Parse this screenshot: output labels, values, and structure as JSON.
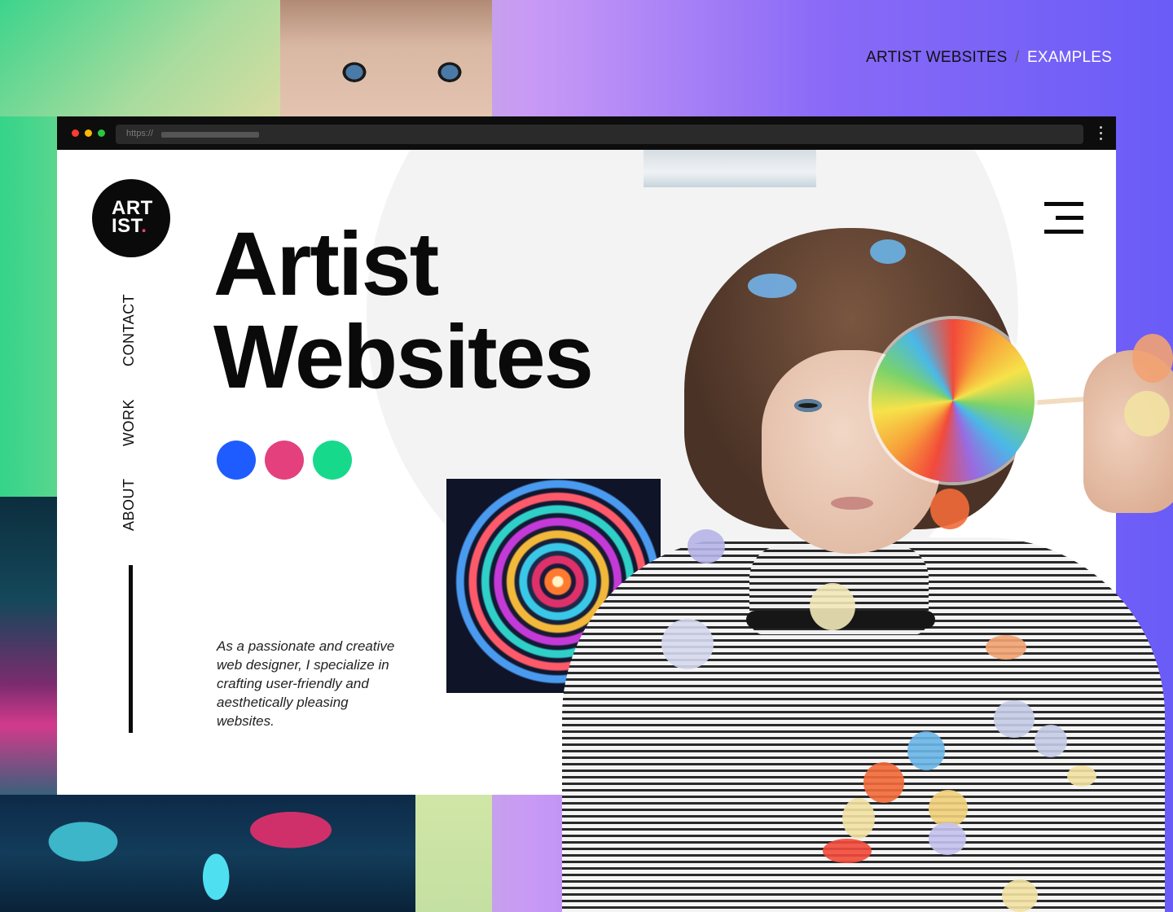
{
  "header": {
    "label_main": "ARTIST WEBSITES",
    "separator": "/",
    "label_sub": "EXAMPLES"
  },
  "browser": {
    "url_prefix": "https://",
    "traffic_lights": [
      "#ff3b30",
      "#ffb800",
      "#28c840"
    ]
  },
  "site": {
    "logo_line1": "ART",
    "logo_line2": "IST",
    "logo_dot": ".",
    "nav": [
      "CONTACT",
      "WORK",
      "ABOUT"
    ],
    "title_line1": "Artist",
    "title_line2": "Websites",
    "swatches": [
      "#1f5cff",
      "#e4407e",
      "#16d98c"
    ],
    "tagline": "As a passionate and creative web designer, I specialize in crafting user-friendly and aesthetically pleasing websites."
  },
  "icons": [
    "hamburger-menu-icon",
    "kebab-menu-icon"
  ]
}
